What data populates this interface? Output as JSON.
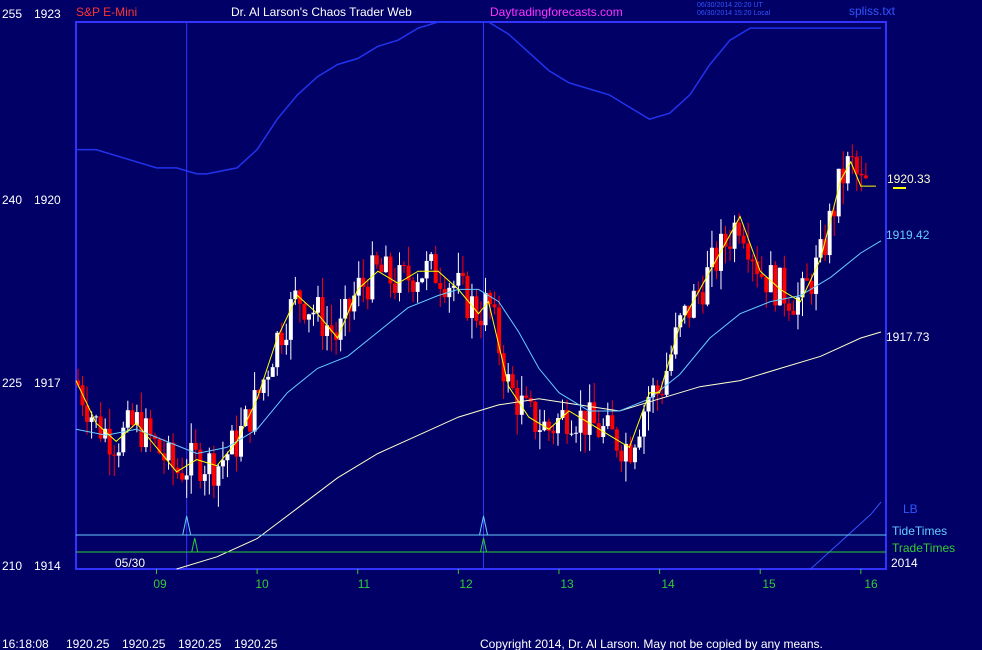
{
  "header": {
    "symbol": "S&P E-Mini",
    "title": "Dr. Al Larson's Chaos Trader Web",
    "site": "Daytradingforecasts.com",
    "stamp1": "06/30/2014 20:20 UT",
    "stamp2": "06/30/2014 15:20 Local",
    "file": "spliss.txt"
  },
  "footer": {
    "time": "16:18:08",
    "quotes": [
      "1920.25",
      "1920.25",
      "1920.25",
      "1920.25"
    ],
    "copyright": "Copyright 2014, Dr. Al Larson. May not be copied by any means."
  },
  "colors": {
    "background": "#000066",
    "frame": "#3333ff",
    "up_bar": "#ffffff",
    "down_bar": "#ff0000",
    "fast_ma": "#ffff00",
    "mid_ma": "#66ccff",
    "slow_ma": "#ffffcc",
    "band": "#2233ee",
    "tide": "#66ccff",
    "trade": "#33cc33",
    "lb": "#3355ff"
  },
  "chart_data": {
    "type": "candlestick",
    "title": "",
    "y_left_labels": [
      "255",
      "240",
      "225",
      "210"
    ],
    "y_right_labels": [
      "1923",
      "1920",
      "1917",
      "1914"
    ],
    "ylim": [
      1914,
      1923
    ],
    "x_tick_labels": [
      "09",
      "10",
      "11",
      "12",
      "13",
      "14",
      "15",
      "16"
    ],
    "x_tick_positions": [
      9,
      10,
      11,
      12,
      13,
      14,
      15,
      16
    ],
    "xlim": [
      8.2,
      16.25
    ],
    "date_label": "05/30",
    "year_label": "2014",
    "legend": [
      "LB",
      "TideTimes",
      "TradeTimes"
    ],
    "price_labels": [
      {
        "label": "1920.33",
        "value": 1920.33,
        "color": "#ffffcc"
      },
      {
        "label": "1919.42",
        "value": 1919.42,
        "color": "#66ccff"
      },
      {
        "label": "1917.73",
        "value": 1917.73,
        "color": "#ffffff"
      }
    ],
    "last_price": 1920.3,
    "tide_pulses": [
      9.3,
      12.25
    ],
    "trade_pulses": [
      9.38,
      12.25
    ],
    "vertical_lines": [
      9.3,
      12.25
    ],
    "series": {
      "fast_ma": {
        "x": [
          8.2,
          8.4,
          8.6,
          8.8,
          9.0,
          9.2,
          9.4,
          9.6,
          9.8,
          10.0,
          10.2,
          10.4,
          10.6,
          10.8,
          11.0,
          11.2,
          11.4,
          11.6,
          11.8,
          12.0,
          12.2,
          12.3,
          12.5,
          12.7,
          12.9,
          13.1,
          13.3,
          13.5,
          13.7,
          13.9,
          14.0,
          14.2,
          14.4,
          14.6,
          14.8,
          15.0,
          15.2,
          15.4,
          15.6,
          15.8,
          15.9,
          16.0,
          16.15
        ],
        "y": [
          1917.1,
          1916.4,
          1916.1,
          1916.4,
          1916.0,
          1915.6,
          1915.8,
          1915.7,
          1916.1,
          1916.8,
          1917.8,
          1918.5,
          1918.2,
          1917.8,
          1918.6,
          1918.9,
          1918.7,
          1918.9,
          1918.9,
          1918.6,
          1918.2,
          1918.4,
          1917.0,
          1916.5,
          1916.3,
          1916.6,
          1916.4,
          1916.2,
          1916.0,
          1916.9,
          1916.9,
          1918.0,
          1918.6,
          1919.2,
          1919.8,
          1918.9,
          1918.6,
          1918.4,
          1919.1,
          1920.4,
          1920.7,
          1920.3,
          1920.3
        ]
      },
      "mid_ma": {
        "x": [
          8.2,
          8.5,
          8.8,
          9.1,
          9.4,
          9.7,
          10.0,
          10.3,
          10.6,
          10.9,
          11.2,
          11.5,
          11.8,
          12.0,
          12.2,
          12.4,
          12.6,
          12.8,
          13.0,
          13.3,
          13.6,
          13.9,
          14.2,
          14.5,
          14.8,
          15.1,
          15.4,
          15.7,
          16.0,
          16.2
        ],
        "y": [
          1916.3,
          1916.2,
          1916.3,
          1916.1,
          1915.9,
          1916.0,
          1916.3,
          1916.9,
          1917.3,
          1917.5,
          1917.9,
          1918.3,
          1918.5,
          1918.6,
          1918.6,
          1918.4,
          1917.9,
          1917.3,
          1916.9,
          1916.6,
          1916.6,
          1916.8,
          1917.2,
          1917.8,
          1918.2,
          1918.4,
          1918.5,
          1918.8,
          1919.2,
          1919.4
        ]
      },
      "slow_ma": {
        "x": [
          9.2,
          9.6,
          10.0,
          10.4,
          10.8,
          11.2,
          11.6,
          12.0,
          12.4,
          12.8,
          13.2,
          13.6,
          14.0,
          14.4,
          14.8,
          15.2,
          15.6,
          16.0,
          16.2
        ],
        "y": [
          1914.0,
          1914.2,
          1914.5,
          1915.0,
          1915.5,
          1915.9,
          1916.2,
          1916.5,
          1916.7,
          1916.8,
          1916.7,
          1916.6,
          1916.8,
          1917.0,
          1917.1,
          1917.3,
          1917.5,
          1917.8,
          1917.9
        ]
      },
      "upper_band": {
        "x": [
          8.2,
          8.4,
          8.6,
          8.8,
          9.0,
          9.2,
          9.4,
          9.5,
          9.8,
          10.0,
          10.2,
          10.4,
          10.6,
          10.8,
          11.0,
          11.2,
          11.4,
          11.6,
          11.8,
          12.0,
          12.1,
          12.3,
          12.5,
          12.7,
          12.9,
          13.1,
          13.3,
          13.5,
          13.7,
          13.9,
          14.1,
          14.3,
          14.5,
          14.7,
          14.9,
          15.1,
          15.3,
          15.5,
          15.7,
          15.9,
          16.1,
          16.2
        ],
        "y": [
          1920.9,
          1920.9,
          1920.8,
          1920.7,
          1920.6,
          1920.6,
          1920.5,
          1920.5,
          1920.6,
          1920.9,
          1921.4,
          1921.8,
          1922.1,
          1922.3,
          1922.4,
          1922.6,
          1922.7,
          1922.9,
          1923.0,
          1923.0,
          1923.0,
          1923.0,
          1922.8,
          1922.5,
          1922.2,
          1922.0,
          1921.9,
          1921.8,
          1921.6,
          1921.4,
          1921.5,
          1921.8,
          1922.3,
          1922.7,
          1922.9,
          1922.9,
          1922.9,
          1922.9,
          1922.9,
          1922.9,
          1922.9,
          1922.9
        ]
      },
      "lb_line": {
        "x": [
          15.5,
          15.7,
          15.9,
          16.1,
          16.2
        ],
        "y": [
          1914.0,
          1914.3,
          1914.6,
          1914.9,
          1915.1
        ]
      }
    }
  }
}
